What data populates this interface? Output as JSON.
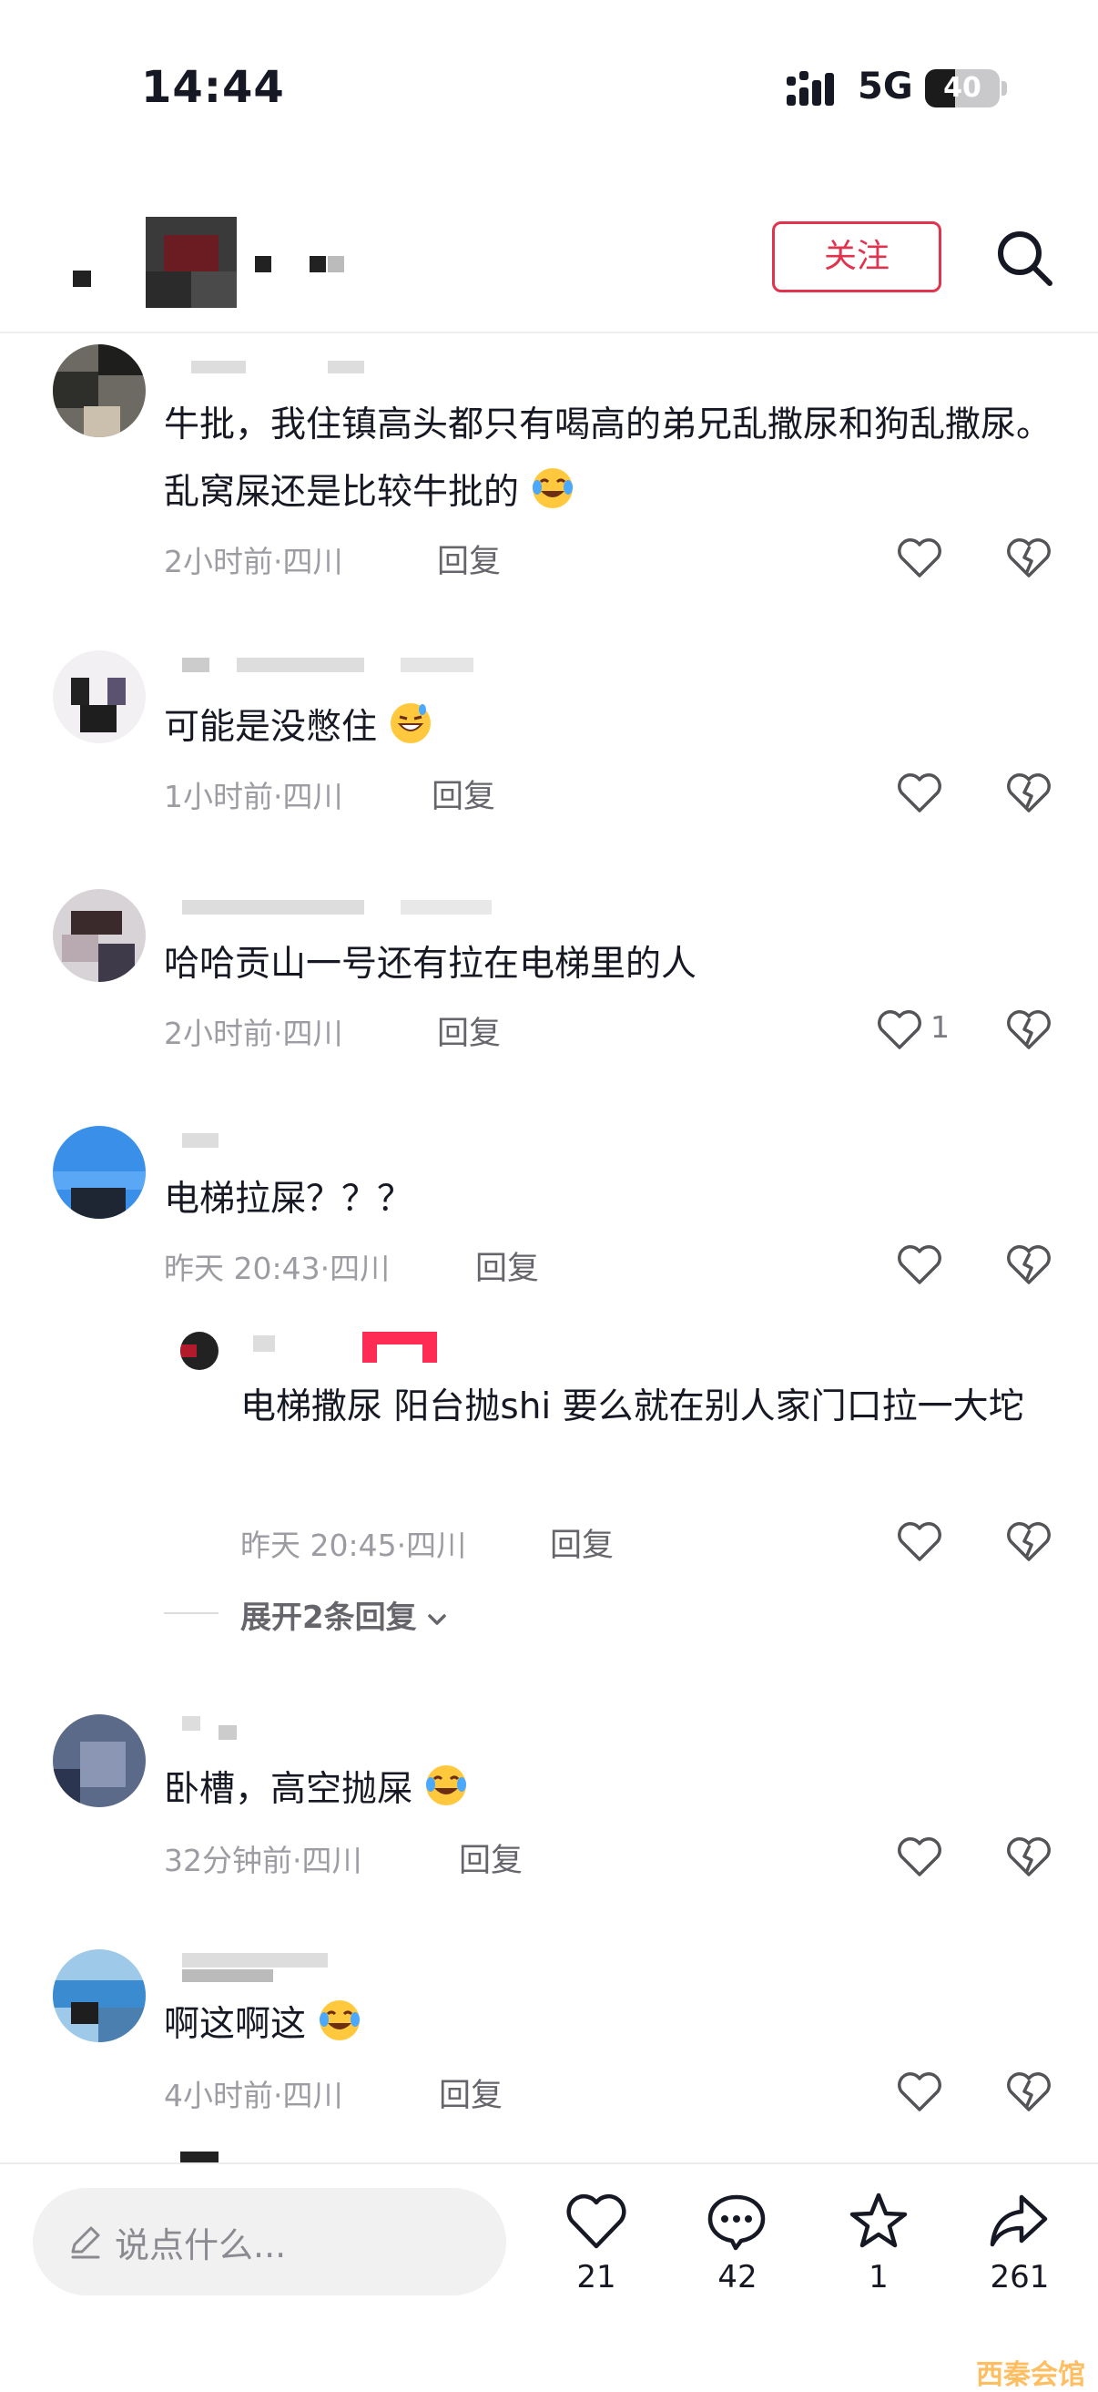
{
  "status_bar": {
    "time": "14:44",
    "network": "5G",
    "battery": "40",
    "battery_level": 0.4
  },
  "header": {
    "follow_label": "关注",
    "search_icon": "search-icon"
  },
  "comments": [
    {
      "text": "牛批，我住镇高头都只有喝高的弟兄乱撒尿和狗乱撒尿。乱窝屎还是比较牛批的",
      "emoji": "tears-of-joy",
      "meta": "2小时前·四川",
      "reply": "回复",
      "likes": ""
    },
    {
      "text": "可能是没憋住",
      "emoji": "grin-sweat",
      "meta": "1小时前·四川",
      "reply": "回复",
      "likes": ""
    },
    {
      "text": "哈哈贡山一号还有拉在电梯里的人",
      "emoji": "",
      "meta": "2小时前·四川",
      "reply": "回复",
      "likes": "1"
    },
    {
      "text": "电梯拉屎？？？",
      "emoji": "",
      "meta": "昨天 20:43·四川",
      "reply": "回复",
      "likes": ""
    }
  ],
  "sub_reply": {
    "text": "电梯撒尿 阳台抛shi 要么就在别人家门口拉一大坨",
    "meta": "昨天 20:45·四川",
    "reply": "回复",
    "likes": ""
  },
  "expand_label": "展开2条回复",
  "comments2": [
    {
      "text": "卧槽，高空抛屎",
      "emoji": "tears-of-joy",
      "meta": "32分钟前·四川",
      "reply": "回复",
      "likes": ""
    },
    {
      "text": "啊这啊这",
      "emoji": "tears-of-joy",
      "meta": "4小时前·四川",
      "reply": "回复",
      "likes": ""
    }
  ],
  "bottom_bar": {
    "placeholder": "说点什么...",
    "likes": "21",
    "comments": "42",
    "favorites": "1",
    "shares": "261"
  },
  "watermark": "西秦会馆",
  "colors": {
    "accent": "#e0334e",
    "text": "#161823",
    "meta": "#9c9ca3"
  }
}
